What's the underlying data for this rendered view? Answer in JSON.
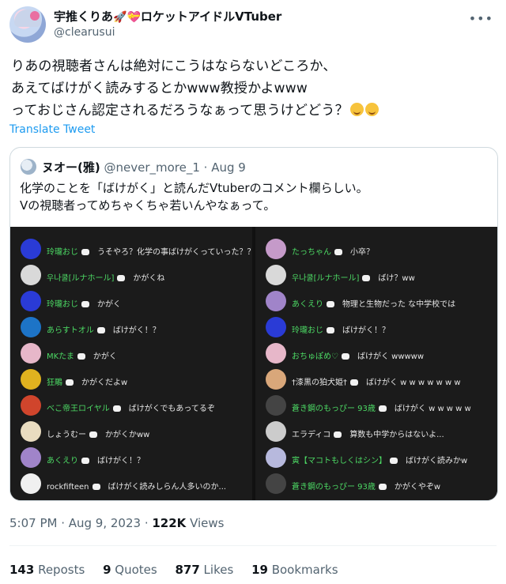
{
  "tweet": {
    "author_name": "宇推くりあ",
    "author_name_suffix": "ロケットアイドルVTuber",
    "handle": "@clearusui",
    "body_lines": [
      "りあの視聴者さんは絶対にこうはならないどころか、",
      "あえてばけがく読みするとかwww教授かよwww",
      "っておじさん認定されるだろうなぁって思うけどどう？"
    ],
    "translate_label": "Translate Tweet",
    "time": "5:07 PM · Aug 9, 2023 · ",
    "views_count": "122K",
    "views_label": " Views",
    "stats": {
      "reposts_count": "143",
      "reposts_label": " Reposts",
      "quotes_count": "9",
      "quotes_label": " Quotes",
      "likes_count": "877",
      "likes_label": " Likes",
      "bookmarks_count": "19",
      "bookmarks_label": " Bookmarks"
    }
  },
  "quote": {
    "author_name": "ヌオー(雅)",
    "meta": " @never_more_1 · Aug 9",
    "lines": [
      "化学のことを「ばけがく」と読んだVtuberのコメント欄らしい。",
      "Vの視聴者ってめちゃくちゃ若いんやなぁって。"
    ]
  },
  "comments_left": [
    {
      "name": "玲瓏おじ",
      "msg": "うそやろ？化学の事ばけがくっていった？？",
      "name_color": "green",
      "avatar_color": "#2a3bd6"
    },
    {
      "name": "우나쿨[ルナホール]",
      "msg": "かがくね",
      "name_color": "green",
      "avatar_color": "#d9d9d9"
    },
    {
      "name": "玲瓏おじ",
      "msg": "かがく",
      "name_color": "green",
      "avatar_color": "#2a3bd6"
    },
    {
      "name": "あらすトオル",
      "msg": "ばけがく！？",
      "name_color": "green",
      "avatar_color": "#1d74c7"
    },
    {
      "name": "MKたま",
      "msg": "かがく",
      "name_color": "green",
      "avatar_color": "#e7b7c9"
    },
    {
      "name": "狂鵰",
      "msg": "かがくだよw",
      "name_color": "green",
      "avatar_color": "#e0b21f"
    },
    {
      "name": "べこ帝王ロイヤル",
      "msg": "ばけがくでもあってるぞ",
      "name_color": "green",
      "avatar_color": "#d0452c"
    },
    {
      "name": "しょうむー",
      "msg": "かがくかww",
      "name_color": "white",
      "avatar_color": "#e9dcc0"
    },
    {
      "name": "あくえり",
      "msg": "ばけがく！？",
      "name_color": "green",
      "avatar_color": "#a084c9"
    },
    {
      "name": "rockfifteen",
      "msg": "ばけがく読みしらん人多いのか...",
      "name_color": "white",
      "avatar_color": "#f0f0f0"
    }
  ],
  "comments_right": [
    {
      "name": "たっちゃん",
      "msg": "小卒？",
      "name_color": "green",
      "avatar_color": "#c59ac9"
    },
    {
      "name": "우나쿨[ルナホール]",
      "msg": "ばけ？ww",
      "name_color": "green",
      "avatar_color": "#d9d9d9"
    },
    {
      "name": "あくえり",
      "msg": "物理と生物だった な中学校では",
      "name_color": "green",
      "avatar_color": "#a084c9"
    },
    {
      "name": "玲瓏おじ",
      "msg": "ばけがく！？",
      "name_color": "green",
      "avatar_color": "#2a3bd6"
    },
    {
      "name": "おちゅぽめ♡",
      "msg": "ばけがく wwwww",
      "name_color": "green",
      "avatar_color": "#e7b7c9"
    },
    {
      "name": "†漆黒の狛犬姫†",
      "msg": "ばけがく w w w w w w w",
      "name_color": "white",
      "avatar_color": "#d9a77a"
    },
    {
      "name": "蒼き鋼のもっぴー 93歳",
      "msg": "ばけがく w w w w w",
      "name_color": "green",
      "avatar_color": "#444444"
    },
    {
      "name": "エラディコ",
      "msg": "算数も中学からはないよ...",
      "name_color": "white",
      "avatar_color": "#cccccc"
    },
    {
      "name": "寅【マコトもしくはシン】",
      "msg": "ばけがく読みかw",
      "name_color": "green",
      "avatar_color": "#b7b9dd"
    },
    {
      "name": "蒼き鋼のもっぴー 93歳",
      "msg": "かがくやぞw",
      "name_color": "green",
      "avatar_color": "#444444"
    }
  ]
}
